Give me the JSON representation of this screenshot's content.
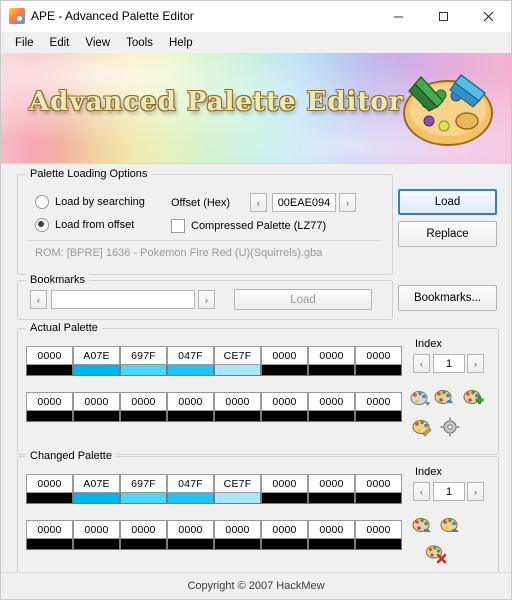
{
  "window": {
    "title": "APE - Advanced Palette Editor",
    "icon": "palette-icon",
    "minimize": "─",
    "maximize": "□",
    "close": "✕"
  },
  "menu": {
    "items": [
      {
        "label": "File"
      },
      {
        "label": "Edit"
      },
      {
        "label": "View"
      },
      {
        "label": "Tools"
      },
      {
        "label": "Help"
      }
    ]
  },
  "banner": {
    "title": "Advanced Palette Editor"
  },
  "palette_loading": {
    "title": "Palette Loading Options",
    "load_by_searching": "Load by searching",
    "load_from_offset": "Load from offset",
    "load_by_searching_checked": false,
    "load_from_offset_checked": true,
    "offset_label": "Offset (Hex)",
    "offset_value": "00EAE094",
    "spin_prev": "‹",
    "spin_next": "›",
    "compressed_label": "Compressed Palette (LZ77)",
    "compressed_checked": false,
    "rom_info": "ROM: [BPRE] 1636 - Pokemon Fire Red (U)(Squirrels).gba",
    "load_button": "Load",
    "replace_button": "Replace"
  },
  "bookmarks": {
    "title": "Bookmarks",
    "prev": "‹",
    "next": "›",
    "value": "",
    "load_button": "Load",
    "manage_button": "Bookmarks..."
  },
  "actual_palette": {
    "title": "Actual Palette",
    "index_label": "Index",
    "index_value": "1",
    "prev": "‹",
    "next": "›",
    "row1": [
      {
        "hex": "0000",
        "color": "#000000"
      },
      {
        "hex": "A07E",
        "color": "#00b4f0"
      },
      {
        "hex": "697F",
        "color": "#50d4f8"
      },
      {
        "hex": "047F",
        "color": "#20c4f8"
      },
      {
        "hex": "CE7F",
        "color": "#a8e8f8"
      },
      {
        "hex": "0000",
        "color": "#000000"
      },
      {
        "hex": "0000",
        "color": "#000000"
      },
      {
        "hex": "0000",
        "color": "#000000"
      }
    ],
    "row2": [
      {
        "hex": "0000",
        "color": "#000000"
      },
      {
        "hex": "0000",
        "color": "#000000"
      },
      {
        "hex": "0000",
        "color": "#000000"
      },
      {
        "hex": "0000",
        "color": "#000000"
      },
      {
        "hex": "0000",
        "color": "#000000"
      },
      {
        "hex": "0000",
        "color": "#000000"
      },
      {
        "hex": "0000",
        "color": "#000000"
      },
      {
        "hex": "0000",
        "color": "#000000"
      }
    ],
    "tools": [
      {
        "name": "palette-import-icon"
      },
      {
        "name": "palette-swap-icon"
      },
      {
        "name": "palette-add-icon"
      },
      {
        "name": "palette-edit-icon"
      },
      {
        "name": "palette-settings-icon"
      }
    ]
  },
  "changed_palette": {
    "title": "Changed Palette",
    "index_label": "Index",
    "index_value": "1",
    "prev": "‹",
    "next": "›",
    "row1": [
      {
        "hex": "0000",
        "color": "#000000"
      },
      {
        "hex": "A07E",
        "color": "#00b4f0"
      },
      {
        "hex": "697F",
        "color": "#50d4f8"
      },
      {
        "hex": "047F",
        "color": "#20c4f8"
      },
      {
        "hex": "CE7F",
        "color": "#a8e8f8"
      },
      {
        "hex": "0000",
        "color": "#000000"
      },
      {
        "hex": "0000",
        "color": "#000000"
      },
      {
        "hex": "0000",
        "color": "#000000"
      }
    ],
    "row2": [
      {
        "hex": "0000",
        "color": "#000000"
      },
      {
        "hex": "0000",
        "color": "#000000"
      },
      {
        "hex": "0000",
        "color": "#000000"
      },
      {
        "hex": "0000",
        "color": "#000000"
      },
      {
        "hex": "0000",
        "color": "#000000"
      },
      {
        "hex": "0000",
        "color": "#000000"
      },
      {
        "hex": "0000",
        "color": "#000000"
      },
      {
        "hex": "0000",
        "color": "#000000"
      }
    ],
    "tools": [
      {
        "name": "palette-undo-icon"
      },
      {
        "name": "palette-redo-icon"
      },
      {
        "name": "palette-delete-icon"
      }
    ]
  },
  "footer": {
    "copyright": "Copyright © 2007 HackMew"
  }
}
